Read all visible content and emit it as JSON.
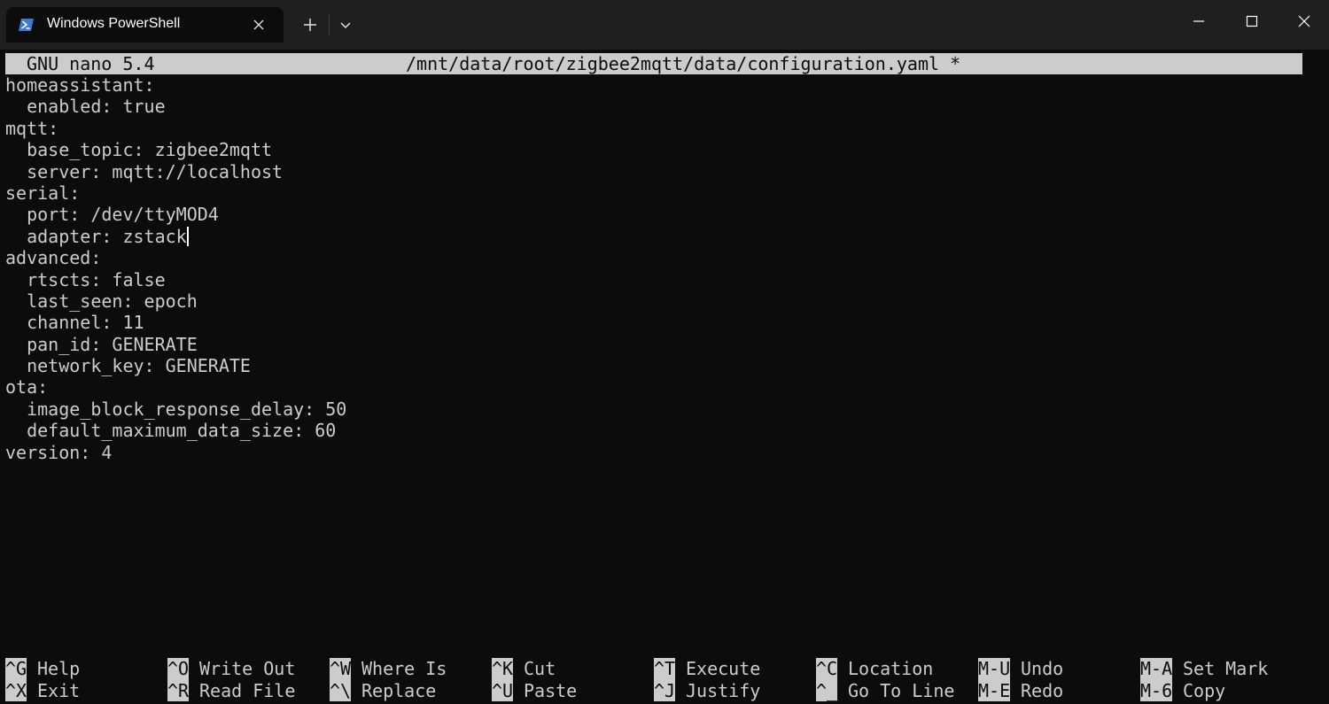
{
  "window": {
    "tab_title": "Windows PowerShell",
    "tab_icon": "powershell-icon",
    "new_tab_icon": "plus-icon",
    "dropdown_icon": "chevron-down-icon"
  },
  "editor": {
    "version": "GNU nano 5.4",
    "filename": "/mnt/data/root/zigbee2mqtt/data/configuration.yaml *",
    "lines": [
      "homeassistant:",
      "  enabled: true",
      "mqtt:",
      "  base_topic: zigbee2mqtt",
      "  server: mqtt://localhost",
      "serial:",
      "  port: /dev/ttyMOD4",
      "  adapter: zstack",
      "advanced:",
      "  rtscts: false",
      "  last_seen: epoch",
      "  channel: 11",
      "  pan_id: GENERATE",
      "  network_key: GENERATE",
      "ota:",
      "  image_block_response_delay: 50",
      "  default_maximum_data_size: 60",
      "version: 4"
    ],
    "cursor_line": 7
  },
  "shortcuts": [
    {
      "key": "^G",
      "label": "Help"
    },
    {
      "key": "^X",
      "label": "Exit"
    },
    {
      "key": "^O",
      "label": "Write Out"
    },
    {
      "key": "^R",
      "label": "Read File"
    },
    {
      "key": "^W",
      "label": "Where Is"
    },
    {
      "key": "^\\",
      "label": "Replace"
    },
    {
      "key": "^K",
      "label": "Cut"
    },
    {
      "key": "^U",
      "label": "Paste"
    },
    {
      "key": "^T",
      "label": "Execute"
    },
    {
      "key": "^J",
      "label": "Justify"
    },
    {
      "key": "^C",
      "label": "Location"
    },
    {
      "key": "^_",
      "label": "Go To Line"
    },
    {
      "key": "M-U",
      "label": "Undo"
    },
    {
      "key": "M-E",
      "label": "Redo"
    },
    {
      "key": "M-A",
      "label": "Set Mark"
    },
    {
      "key": "M-6",
      "label": "Copy"
    }
  ]
}
